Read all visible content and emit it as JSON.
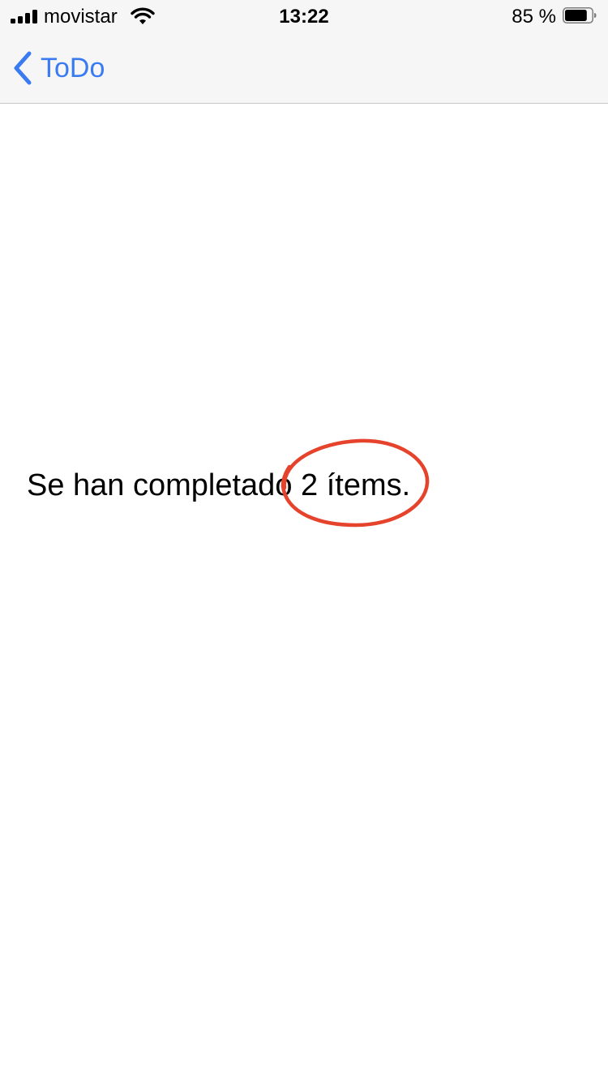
{
  "status_bar": {
    "carrier": "movistar",
    "time": "13:22",
    "battery_percent": "85 %",
    "battery_level": 0.85,
    "icons": [
      "signal-icon",
      "wifi-icon",
      "battery-icon"
    ]
  },
  "nav": {
    "back_label": "ToDo",
    "back_icon": "chevron-left-icon",
    "accent_color": "#3a7bf2"
  },
  "main": {
    "message": "Se han completado 2 ítems."
  },
  "annotation": {
    "shape": "ellipse",
    "color": "#e5432b"
  }
}
